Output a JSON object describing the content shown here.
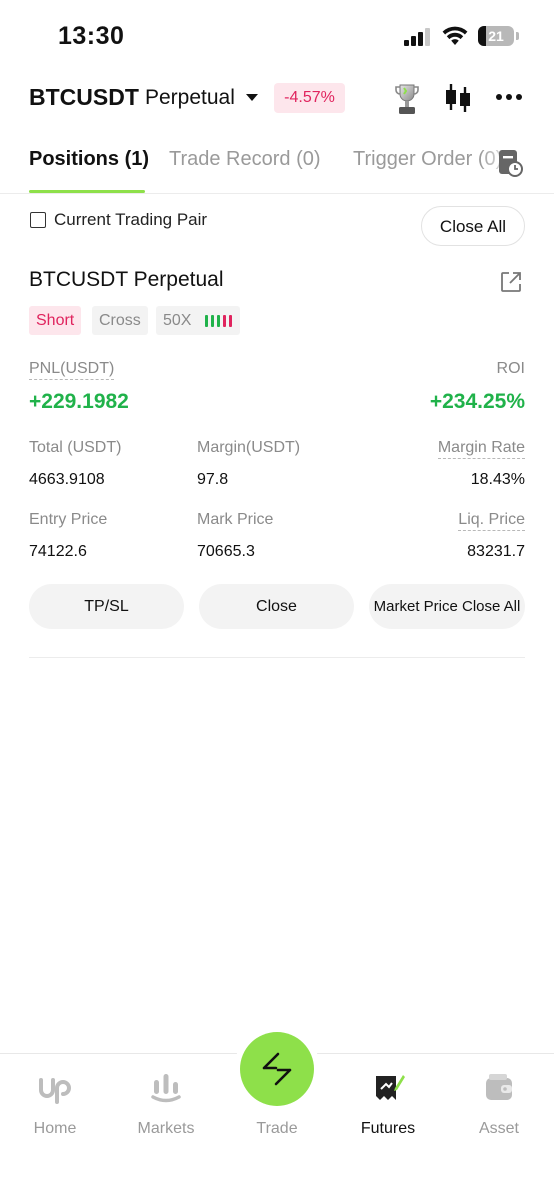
{
  "status_bar": {
    "time": "13:30",
    "battery": "21",
    "battery_level": 0.21
  },
  "header": {
    "pair": "BTCUSDT",
    "contract_type": "Perpetual",
    "change": "-4.57%",
    "icons": [
      "trophy-icon",
      "candlestick-icon",
      "more-icon"
    ]
  },
  "tabs": [
    {
      "label": "Positions (1)",
      "active": true
    },
    {
      "label": "Trade Record (0)",
      "active": false
    },
    {
      "label": "Trigger Order (0)",
      "active": false
    }
  ],
  "filter": {
    "current_pair_label": "Current Trading Pair",
    "current_pair_checked": false,
    "close_all": "Close All"
  },
  "position": {
    "title": "BTCUSDT Perpetual",
    "side": "Short",
    "margin_mode": "Cross",
    "leverage": "50X",
    "pnl_label": "PNL(USDT)",
    "pnl": "+229.1982",
    "roi_label": "ROI",
    "roi": "+234.25%",
    "total_label": "Total (USDT)",
    "total": "4663.9108",
    "margin_label": "Margin(USDT)",
    "margin": "97.8",
    "margin_rate_label": "Margin Rate",
    "margin_rate": "18.43%",
    "entry_label": "Entry Price",
    "entry": "74122.6",
    "mark_label": "Mark Price",
    "mark": "70665.3",
    "liq_label": "Liq. Price",
    "liq": "83231.7"
  },
  "actions": {
    "tpsl": "TP/SL",
    "close": "Close",
    "market_close_all": "Market Price Close All"
  },
  "bottom_nav": [
    {
      "label": "Home",
      "icon": "home-logo-icon",
      "active": false
    },
    {
      "label": "Markets",
      "icon": "markets-icon",
      "active": false
    },
    {
      "label": "Trade",
      "icon": "trade-icon",
      "active": false
    },
    {
      "label": "Futures",
      "icon": "futures-icon",
      "active": true
    },
    {
      "label": "Asset",
      "icon": "wallet-icon",
      "active": false
    }
  ],
  "colors": {
    "accent": "#8ee04a",
    "positive": "#20b24a",
    "negative": "#e0245e"
  }
}
